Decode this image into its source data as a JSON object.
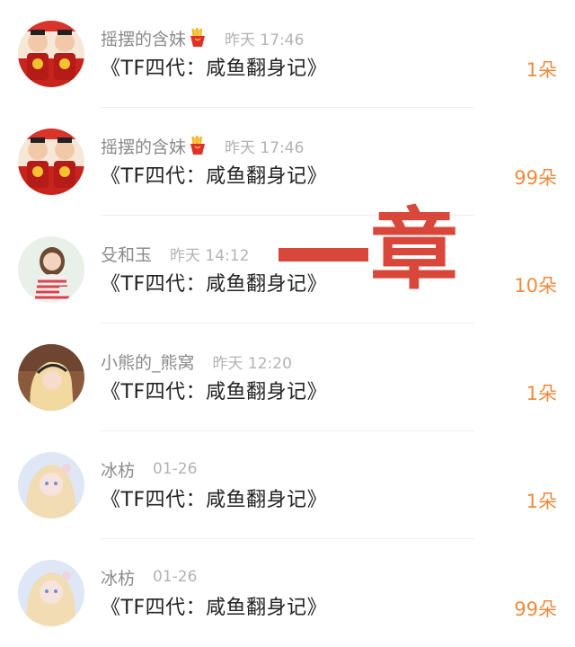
{
  "rows": [
    {
      "username": "摇摆的含妹",
      "has_emoji": true,
      "time": "昨天 17:46",
      "title": "《TF四代：咸鱼翻身记》",
      "count": "1朵",
      "avatar": "avatar-red-costume"
    },
    {
      "username": "摇摆的含妹",
      "has_emoji": true,
      "time": "昨天 17:46",
      "title": "《TF四代：咸鱼翻身记》",
      "count": "99朵",
      "avatar": "avatar-red-costume"
    },
    {
      "username": "殳和玉",
      "has_emoji": false,
      "time": "昨天 14:12",
      "title": "《TF四代：咸鱼翻身记》",
      "count": "10朵",
      "avatar": "avatar-girl-striped"
    },
    {
      "username": "小熊的_熊窝",
      "has_emoji": false,
      "time": "昨天 12:20",
      "title": "《TF四代：咸鱼翻身记》",
      "count": "1朵",
      "avatar": "avatar-anime-girl"
    },
    {
      "username": "冰枋",
      "has_emoji": false,
      "time": "01-26",
      "title": "《TF四代：咸鱼翻身记》",
      "count": "1朵",
      "avatar": "avatar-blonde-doll"
    },
    {
      "username": "冰枋",
      "has_emoji": false,
      "time": "01-26",
      "title": "《TF四代：咸鱼翻身记》",
      "count": "99朵",
      "avatar": "avatar-blonde-doll"
    }
  ],
  "watermark": {
    "text": "一章"
  },
  "colors": {
    "count": "#f08a3c",
    "username": "#8a8a8a",
    "time": "#b3b3b3",
    "title": "#222222",
    "watermark": "#d8473a"
  },
  "icons": {
    "emoji": "french-fries-icon"
  }
}
